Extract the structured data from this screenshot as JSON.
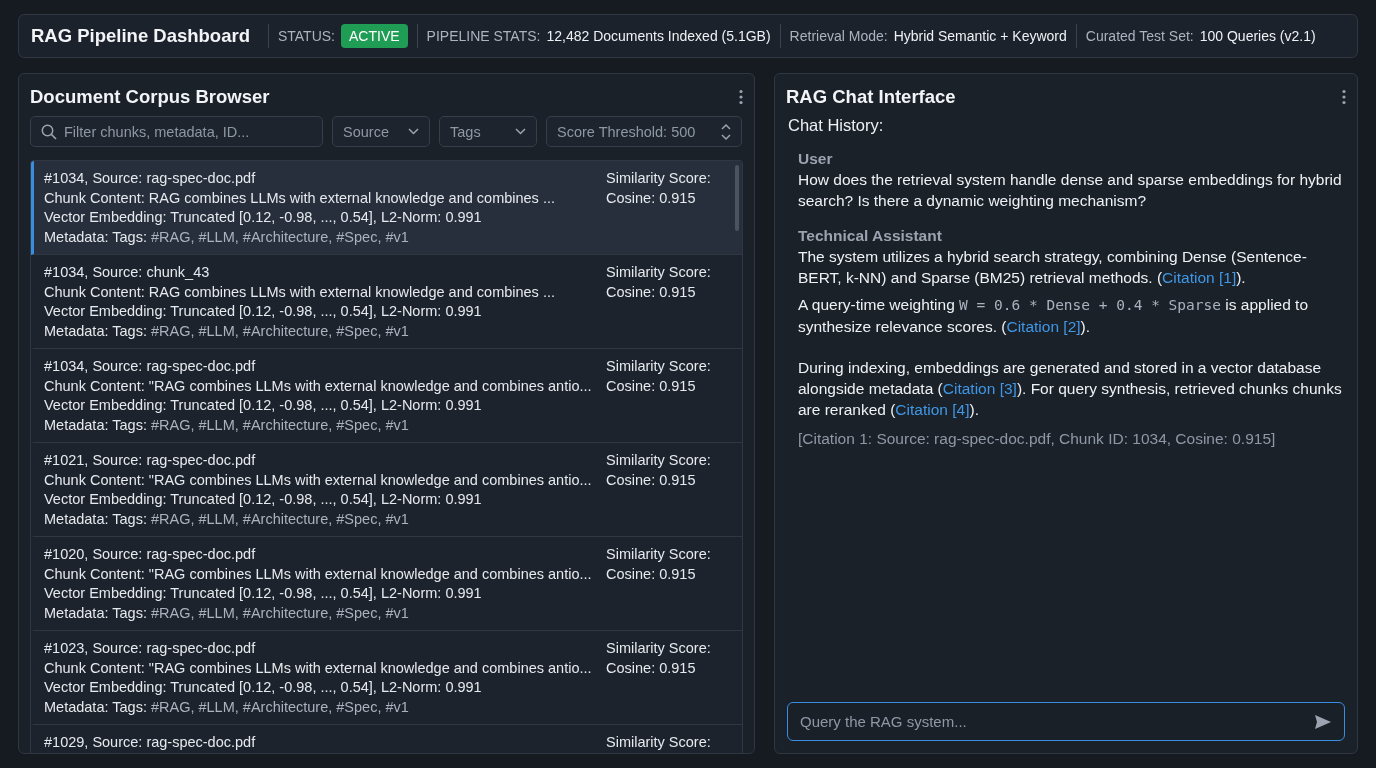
{
  "header": {
    "title": "RAG Pipeline Dashboard",
    "status": {
      "label": "STATUS:",
      "badge": "ACTIVE",
      "active": true
    },
    "stats": [
      {
        "label": "PIPELINE STATS:",
        "value": "12,482 Documents Indexed (5.1GB)"
      },
      {
        "label": "Retrieval Mode:",
        "value": "Hybrid Semantic + Keyword"
      },
      {
        "label": "Curated Test Set:",
        "value": "100 Queries (v2.1)"
      }
    ]
  },
  "corpus": {
    "title": "Document Corpus Browser",
    "search": {
      "placeholder": "Filter chunks, metadata, ID..."
    },
    "filters": [
      {
        "kind": "dropdown",
        "label": "Source"
      },
      {
        "kind": "dropdown",
        "label": "Tags"
      },
      {
        "kind": "stepper",
        "label": "Score Threshold: 500"
      }
    ],
    "chunks": [
      {
        "selected": true,
        "heading": "#1034, Source: rag-spec-doc.pdf",
        "content": "Chunk Content: RAG combines LLMs with external knowledge and combines ...",
        "embedding": "Vector Embedding: Truncated [0.12, -0.98, ..., 0.54], L2-Norm: 0.991",
        "metadata_label": "Metadata: Tags:",
        "tags": "#RAG, #LLM, #Architecture, #Spec, #v1",
        "score_label": "Similarity Score:",
        "score": "Cosine: 0.915"
      },
      {
        "selected": false,
        "heading": "#1034, Source: chunk_43",
        "content": "Chunk Content: RAG combines LLMs with external knowledge and combines ...",
        "embedding": "Vector Embedding: Truncated [0.12, -0.98, ..., 0.54], L2-Norm: 0.991",
        "metadata_label": "Metadata: Tags:",
        "tags": "#RAG, #LLM, #Architecture, #Spec, #v1",
        "score_label": "Similarity Score:",
        "score": "Cosine: 0.915"
      },
      {
        "selected": false,
        "heading": "#1034, Source: rag-spec-doc.pdf",
        "content": "Chunk Content: \"RAG combines LLMs with external knowledge and combines antio...",
        "embedding": "Vector Embedding: Truncated [0.12, -0.98, ..., 0.54], L2-Norm: 0.991",
        "metadata_label": "Metadata: Tags:",
        "tags": "#RAG, #LLM, #Architecture, #Spec, #v1",
        "score_label": "Similarity Score:",
        "score": "Cosine: 0.915"
      },
      {
        "selected": false,
        "heading": "#1021, Source: rag-spec-doc.pdf",
        "content": "Chunk Content: \"RAG combines LLMs with external knowledge and combines antio...",
        "embedding": "Vector Embedding: Truncated [0.12, -0.98, ..., 0.54], L2-Norm: 0.991",
        "metadata_label": "Metadata: Tags:",
        "tags": "#RAG, #LLM, #Architecture, #Spec, #v1",
        "score_label": "Similarity Score:",
        "score": "Cosine: 0.915"
      },
      {
        "selected": false,
        "heading": "#1020, Source: rag-spec-doc.pdf",
        "content": "Chunk Content: \"RAG combines LLMs with external knowledge and combines antio...",
        "embedding": "Vector Embedding: Truncated [0.12, -0.98, ..., 0.54], L2-Norm: 0.991",
        "metadata_label": "Metadata: Tags:",
        "tags": "#RAG, #LLM, #Architecture, #Spec, #v1",
        "score_label": "Similarity Score:",
        "score": "Cosine: 0.915"
      },
      {
        "selected": false,
        "heading": "#1023, Source: rag-spec-doc.pdf",
        "content": "Chunk Content: \"RAG combines LLMs with external knowledge and combines antio...",
        "embedding": "Vector Embedding: Truncated [0.12, -0.98, ..., 0.54], L2-Norm: 0.991",
        "metadata_label": "Metadata: Tags:",
        "tags": "#RAG, #LLM, #Architecture, #Spec, #v1",
        "score_label": "Similarity Score:",
        "score": "Cosine: 0.915"
      },
      {
        "selected": false,
        "heading": "#1029, Source: rag-spec-doc.pdf",
        "score_label": "Similarity Score:"
      }
    ]
  },
  "chat": {
    "title": "RAG Chat Interface",
    "history_label": "Chat History:",
    "messages": [
      {
        "author": "User",
        "paragraphs": [
          [
            {
              "kind": "text",
              "text": "How does the retrieval system handle dense and sparse embeddings for hybrid search? Is there a dynamic weighting mechanism?"
            }
          ]
        ]
      },
      {
        "author": "Technical Assistant",
        "paragraphs": [
          [
            {
              "kind": "text",
              "text": "The system utilizes a hybrid search strategy, combining Dense (Sentence-BERT, k-NN) and Sparse (BM25) retrieval methods. ("
            },
            {
              "kind": "link",
              "text": "Citation [1]"
            },
            {
              "kind": "text",
              "text": ")."
            }
          ],
          [
            {
              "kind": "text",
              "text": "A query-time weighting "
            },
            {
              "kind": "code",
              "text": "W = 0.6 * Dense + 0.4 * Sparse"
            },
            {
              "kind": "text",
              "text": " is applied to synthesize relevance scores. ("
            },
            {
              "kind": "link",
              "text": "Citation [2]"
            },
            {
              "kind": "text",
              "text": ")."
            }
          ],
          [
            {
              "kind": "text",
              "text": "During indexing, embeddings are generated and stored in a vector database alongside metadata ("
            },
            {
              "kind": "link",
              "text": "Citation [3]"
            },
            {
              "kind": "text",
              "text": "). For query synthesis, retrieved chunks chunks are reranked ("
            },
            {
              "kind": "link",
              "text": "Citation [4]"
            },
            {
              "kind": "text",
              "text": ")."
            }
          ]
        ],
        "note": "[Citation 1: Source: rag-spec-doc.pdf, Chunk ID: 1034, Cosine: 0.915]"
      }
    ],
    "input": {
      "placeholder": "Query the RAG system..."
    }
  }
}
